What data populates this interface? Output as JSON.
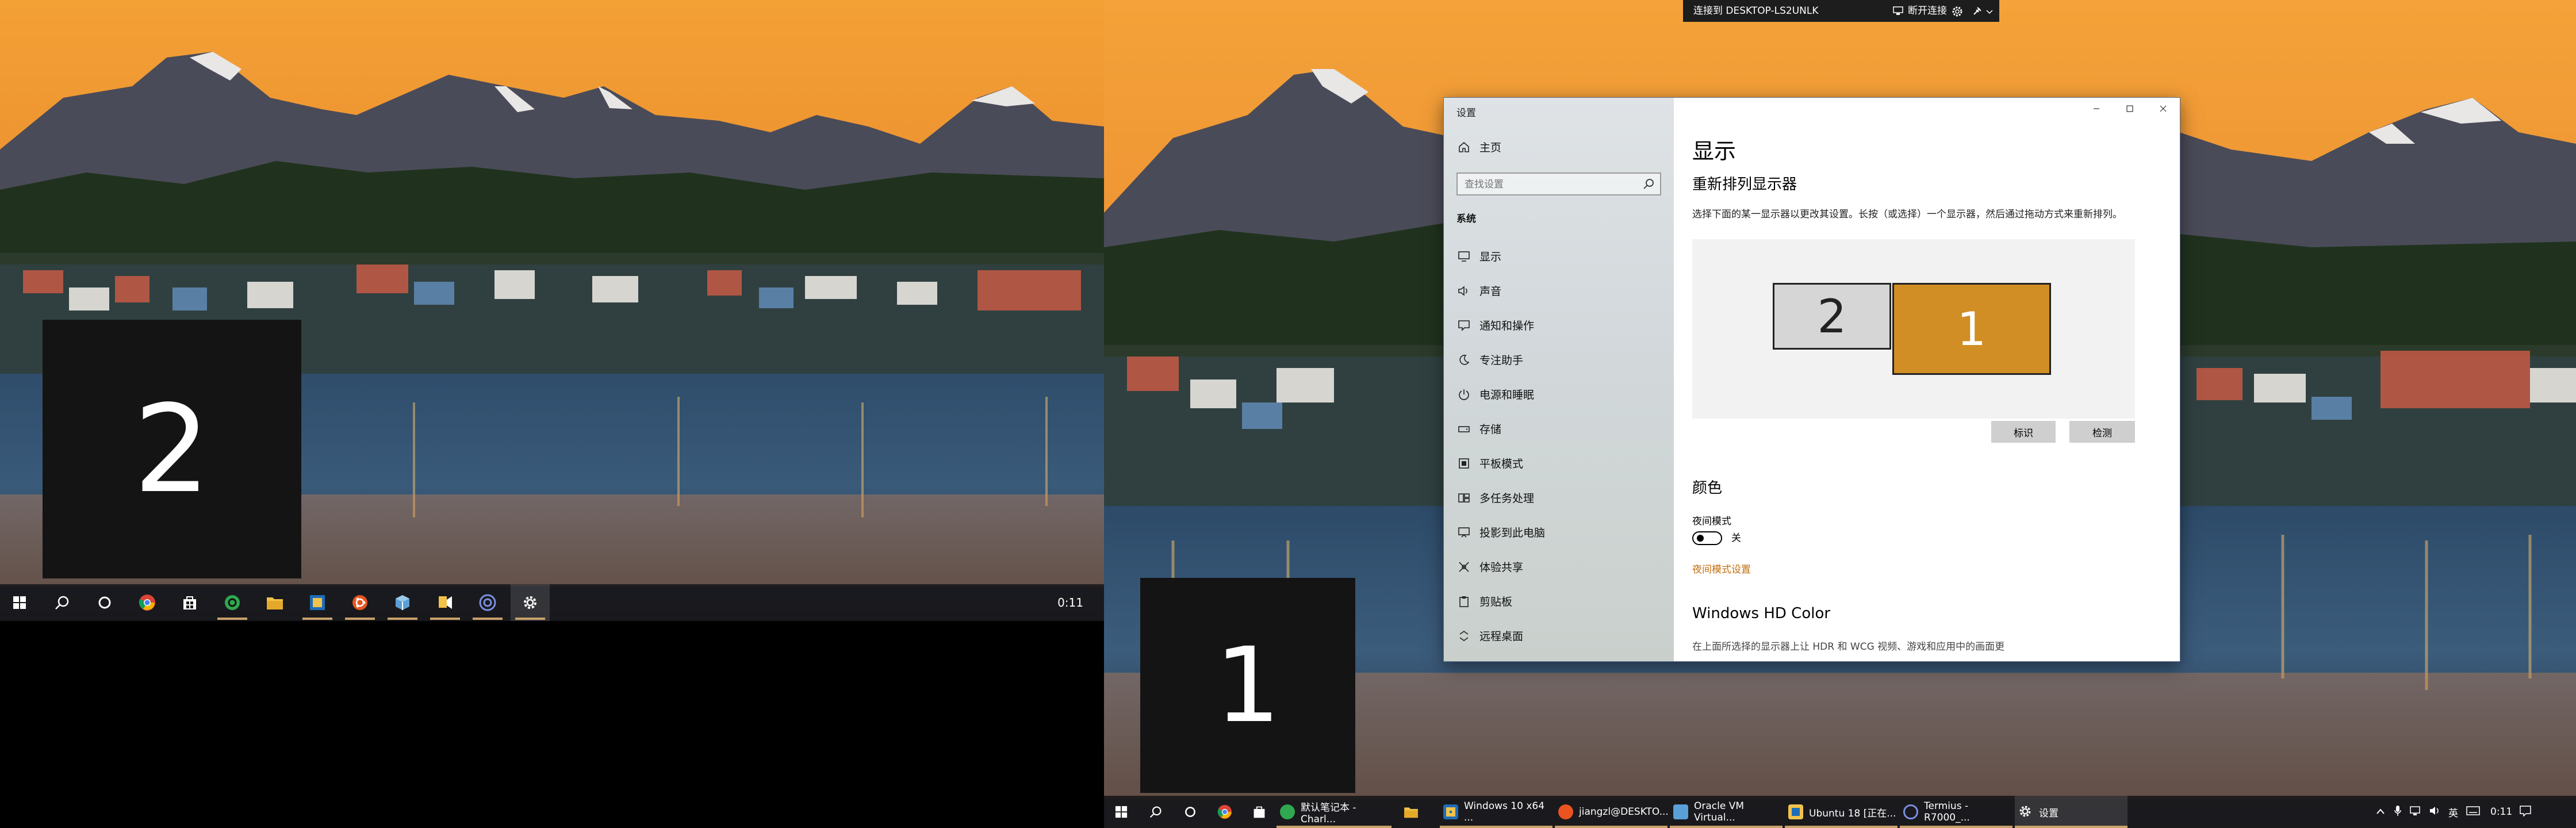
{
  "colors": {
    "accent": "#d08e24",
    "link": "#c16e10",
    "taskbar": "#1a181a",
    "active_underline": "#c9a16a"
  },
  "displays": {
    "left_identify_number": "2",
    "right_identify_number": "1"
  },
  "taskbar_left": {
    "icons": [
      "windows-start-icon",
      "search-icon",
      "cortana-icon",
      "chrome-icon",
      "store-icon",
      "green-app-icon",
      "file-explorer-icon",
      "folder-app-icon",
      "ubuntu-icon",
      "virtualbox-icon",
      "sticky-tool-icon",
      "terminus-icon",
      "settings-gear-icon"
    ],
    "clock": "0:11"
  },
  "rdp_bar": {
    "title": "连接到 DESKTOP-LS2UNLK",
    "disconnect_label": "断开连接"
  },
  "settings": {
    "app_title": "设置",
    "home": "主页",
    "search_placeholder": "查找设置",
    "section_heading": "系统",
    "nav_items": [
      {
        "label": "显示",
        "icon": "monitor-icon"
      },
      {
        "label": "声音",
        "icon": "speaker-icon"
      },
      {
        "label": "通知和操作",
        "icon": "notification-icon"
      },
      {
        "label": "专注助手",
        "icon": "moon-icon"
      },
      {
        "label": "电源和睡眠",
        "icon": "power-icon"
      },
      {
        "label": "存储",
        "icon": "storage-icon"
      },
      {
        "label": "平板模式",
        "icon": "tablet-icon"
      },
      {
        "label": "多任务处理",
        "icon": "multitask-icon"
      },
      {
        "label": "投影到此电脑",
        "icon": "project-icon"
      },
      {
        "label": "体验共享",
        "icon": "share-icon"
      },
      {
        "label": "剪贴板",
        "icon": "clipboard-icon"
      },
      {
        "label": "远程桌面",
        "icon": "remote-icon"
      }
    ],
    "main": {
      "title": "显示",
      "arrange_heading": "重新排列显示器",
      "arrange_desc": "选择下面的某一显示器以更改其设置。长按（或选择）一个显示器，然后通过拖动方式来重新排列。",
      "monitor_2_label": "2",
      "monitor_1_label": "1",
      "identify_button": "标识",
      "detect_button": "检测",
      "color_heading": "颜色",
      "night_light_label": "夜间模式",
      "night_light_state": "关",
      "night_light_link": "夜间模式设置",
      "hdr_heading": "Windows HD Color",
      "hdr_desc": "在上面所选择的显示器上让 HDR 和 WCG 视频、游戏和应用中的画面更"
    }
  },
  "taskbar_right": {
    "tasks": [
      {
        "label": "默认笔记本 - Charl...",
        "icon": "green-app-icon"
      },
      {
        "label": "Windows 10 x64 ...",
        "icon": "virtualbox-window-icon"
      },
      {
        "label": "jiangzl@DESKTO...",
        "icon": "ubuntu-icon"
      },
      {
        "label": "Oracle VM Virtual...",
        "icon": "virtualbox-icon"
      },
      {
        "label": "Ubuntu 18 [正在...",
        "icon": "virtualbox-window-icon"
      },
      {
        "label": "Termius - R7000_...",
        "icon": "terminus-icon"
      },
      {
        "label": "设置",
        "icon": "settings-gear-icon"
      }
    ],
    "ime": "英",
    "clock": "0:11"
  }
}
